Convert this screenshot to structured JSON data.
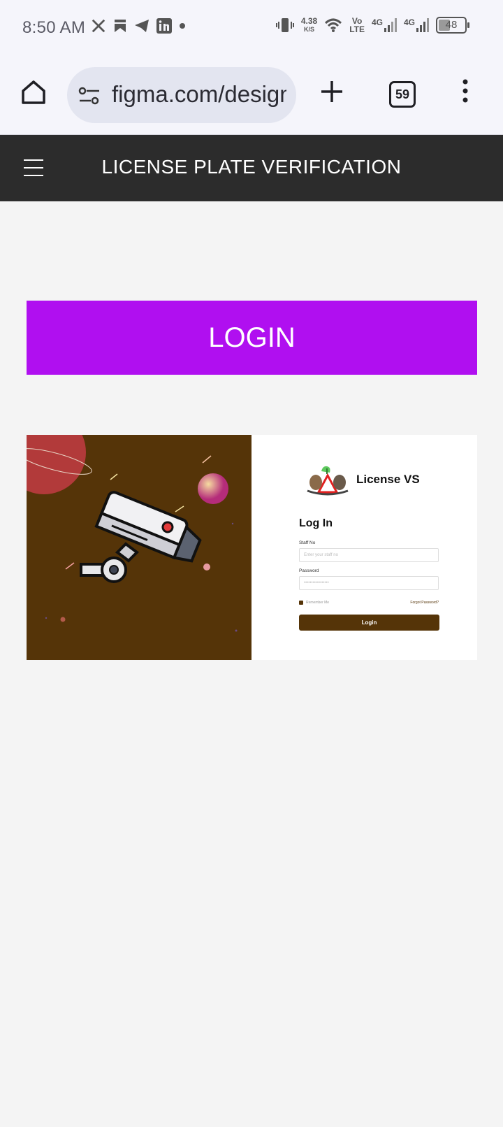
{
  "status_bar": {
    "time": "8:50 AM",
    "net_speed": "4.38",
    "net_unit": "K/S",
    "volte_top": "Vo",
    "volte_bottom": "LTE",
    "sim1": "4G",
    "sim2": "4G",
    "battery": "48"
  },
  "browser": {
    "url": "figma.com/design",
    "tab_count": "59"
  },
  "site": {
    "title": "LICENSE PLATE VERIFICATION",
    "login_banner": "LOGIN"
  },
  "preview": {
    "brand": "License VS",
    "form_title": "Log In",
    "staff_label": "Staff No",
    "staff_placeholder": "Enter your staff no",
    "password_label": "Password",
    "password_placeholder": "•••••••••••••••••",
    "remember_label": "Remember Me",
    "forgot_label": "Forgot Password?",
    "login_button": "Login",
    "colors": {
      "brown": "#553408",
      "purple": "#b00ff0"
    }
  }
}
